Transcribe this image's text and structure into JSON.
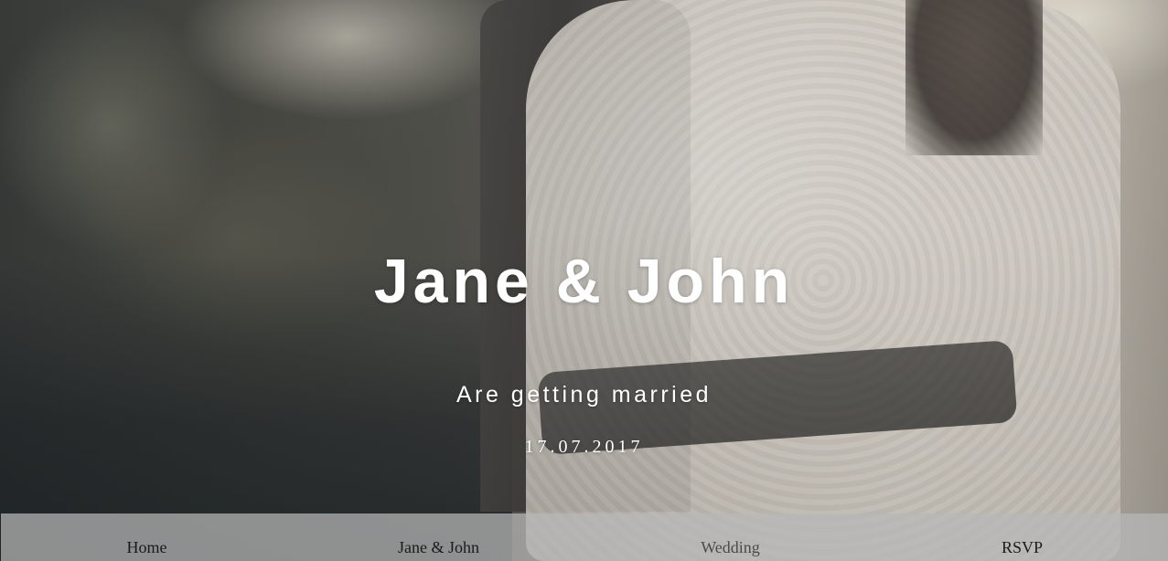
{
  "hero": {
    "title": "Jane & John",
    "subtitle": "Are getting married",
    "date": "17.07.2017"
  },
  "nav": {
    "items": [
      {
        "label": "Home"
      },
      {
        "label": "Jane & John"
      },
      {
        "label": "Wedding"
      },
      {
        "label": "RSVP"
      }
    ]
  },
  "colors": {
    "text": "#ffffff",
    "nav_background": "#b9b9b9",
    "nav_text": "#1a1a1a"
  }
}
